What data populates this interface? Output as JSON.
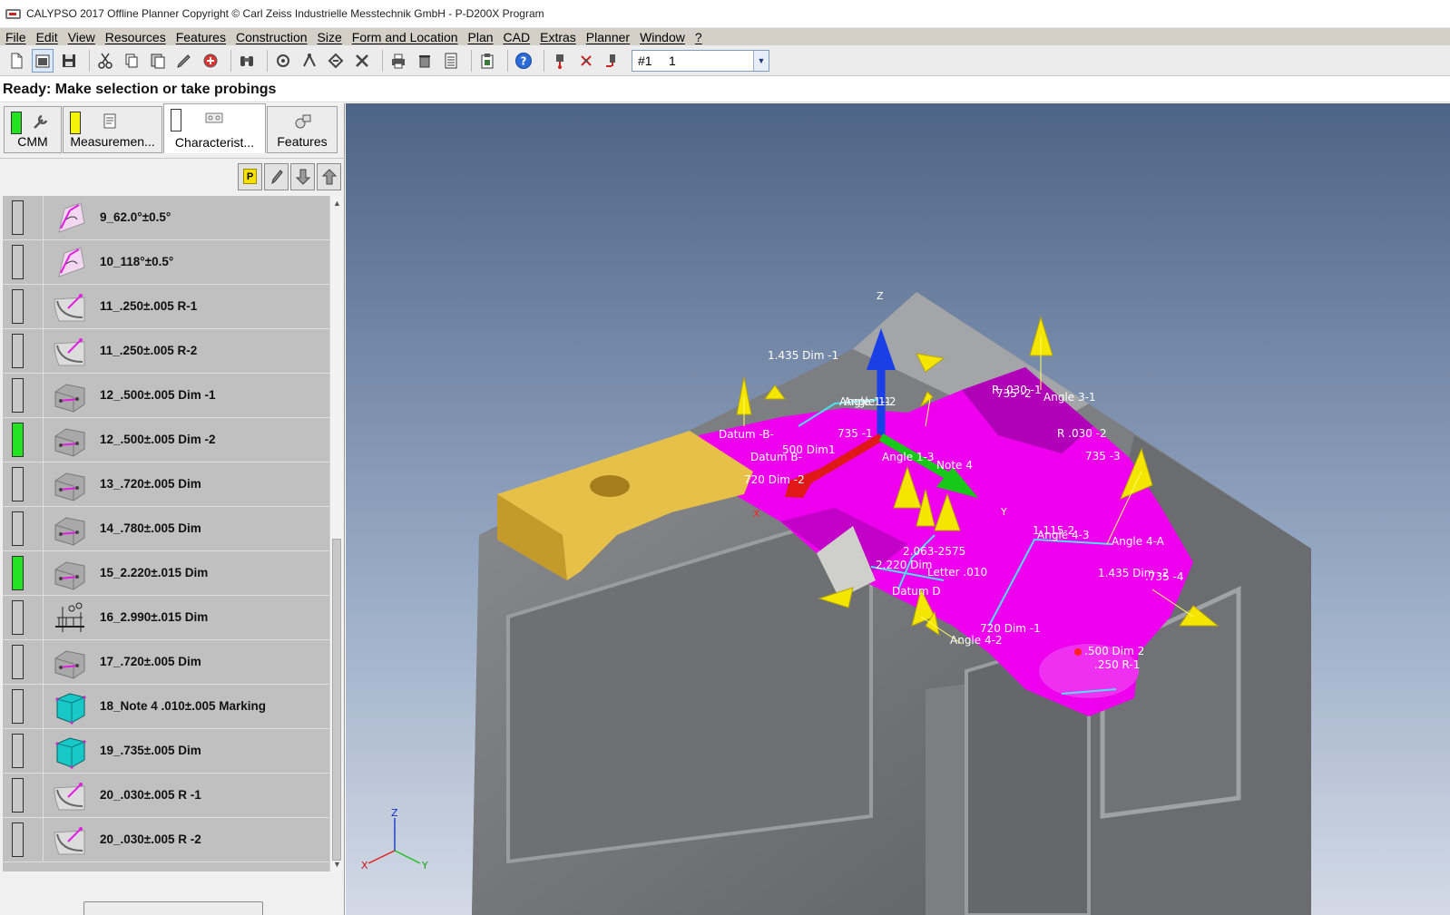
{
  "window": {
    "title": "CALYPSO 2017 Offline Planner Copyright © Carl Zeiss Industrielle Messtechnik GmbH - P-D200X Program"
  },
  "menu": [
    "File",
    "Edit",
    "View",
    "Resources",
    "Features",
    "Construction",
    "Size",
    "Form and Location",
    "Plan",
    "CAD",
    "Extras",
    "Planner",
    "Window",
    "?"
  ],
  "toolbar": {
    "probe_prefix": "#1",
    "probe_value": "1"
  },
  "status": "Ready: Make selection or take probings",
  "tabs": [
    {
      "label": "CMM",
      "swatch": "#22e222"
    },
    {
      "label": "Measuremen...",
      "swatch": "#f4f40a"
    },
    {
      "label": "Characterist...",
      "swatch": "#ffffff"
    },
    {
      "label": "Features"
    }
  ],
  "list_toolbar": {
    "p_label": "P"
  },
  "characteristics": [
    {
      "label": "9_62.0°±0.5°",
      "status": "grey",
      "icon": "angle-icon"
    },
    {
      "label": "10_118°±0.5°",
      "status": "grey",
      "icon": "angle-icon"
    },
    {
      "label": "11_.250±.005 R-1",
      "status": "grey",
      "icon": "radius-icon"
    },
    {
      "label": "11_.250±.005 R-2",
      "status": "grey",
      "icon": "radius-icon"
    },
    {
      "label": "12_.500±.005 Dim -1",
      "status": "grey",
      "icon": "distance-icon"
    },
    {
      "label": "12_.500±.005 Dim -2",
      "status": "green",
      "icon": "distance-icon"
    },
    {
      "label": "13_.720±.005 Dim",
      "status": "grey",
      "icon": "distance-icon"
    },
    {
      "label": "14_.780±.005 Dim",
      "status": "grey",
      "icon": "distance-icon"
    },
    {
      "label": "15_2.220±.015 Dim",
      "status": "green",
      "icon": "distance-icon"
    },
    {
      "label": "16_2.990±.015 Dim",
      "status": "grey",
      "icon": "measure-fixture-icon"
    },
    {
      "label": "17_.720±.005 Dim",
      "status": "grey",
      "icon": "distance-icon"
    },
    {
      "label": "18_Note 4 .010±.005 Marking",
      "status": "grey",
      "icon": "cube-icon"
    },
    {
      "label": "19_.735±.005 Dim",
      "status": "grey",
      "icon": "cube-icon"
    },
    {
      "label": "20_.030±.005 R -1",
      "status": "grey",
      "icon": "radius-icon"
    },
    {
      "label": "20_.030±.005 R -2",
      "status": "grey",
      "icon": "radius-icon"
    }
  ],
  "view3d": {
    "axes": {
      "x": "X",
      "y": "Y",
      "z": "Z"
    },
    "annotations": [
      "1.435 Dim -1",
      "Angle 1-1",
      "Angle 1-2",
      "R .030 -1",
      "735 -2",
      "Angle 3-1",
      "Datum -B-",
      "735 -1",
      "500 Dim1",
      "Datum B-",
      "R .030 -2",
      "735 -3",
      "720 Dim -2",
      "Angle 1-3",
      "Note 4",
      "Angle 4-3",
      "Angle 4-A",
      "1.435 Dim -2",
      ".735 -4",
      "2.063-2575",
      "2.220 Dim",
      "Datum D",
      "Letter .010",
      "720 Dim -1",
      "Angle 4-2",
      ".500 Dim 2",
      ".250 R-1",
      "1.115-2"
    ]
  }
}
